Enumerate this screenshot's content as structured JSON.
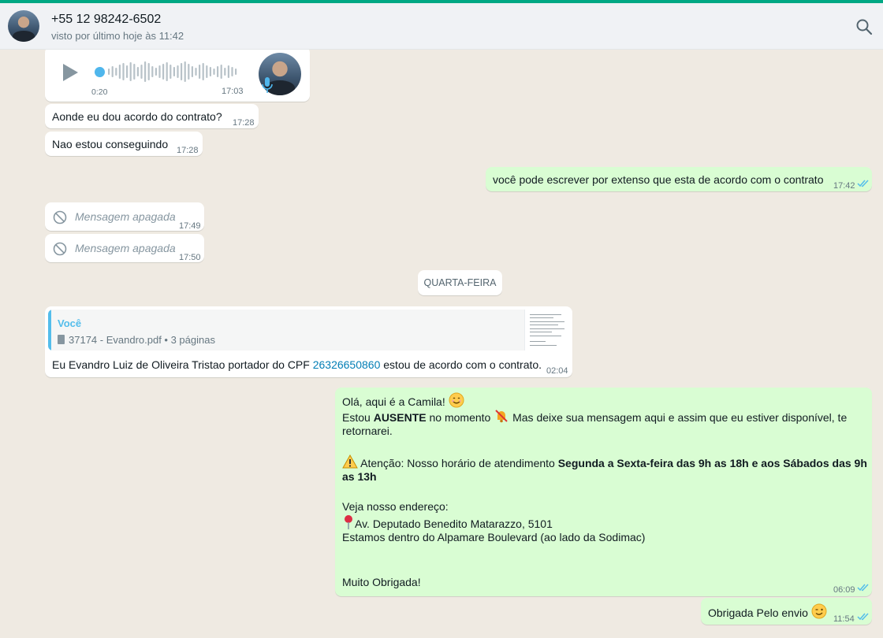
{
  "header": {
    "name": "+55 12 98242-6502",
    "status": "visto por último hoje às 11:42"
  },
  "audio": {
    "elapsed": "0:20",
    "time": "17:03"
  },
  "messages": [
    {
      "text": "Aonde eu dou acordo do contrato?",
      "time": "17:28"
    },
    {
      "text": "Nao estou conseguindo",
      "time": "17:28"
    },
    {
      "text": "você pode escrever por extenso que esta de acordo com o contrato",
      "time": "17:42"
    },
    {
      "text": "Mensagem apagada",
      "time": "17:49"
    },
    {
      "text": "Mensagem apagada",
      "time": "17:50"
    }
  ],
  "date_divider": "QUARTA-FEIRA",
  "reply": {
    "quoted_author": "Você",
    "quoted_doc": "37174 - Evandro.pdf • 3 páginas",
    "text_before": "Eu Evandro Luiz de Oliveira Tristao portador do CPF ",
    "cpf": "26326650860",
    "text_after": " estou de acordo com o contrato.",
    "time": "02:04"
  },
  "auto_reply": {
    "line1": "Olá, aqui é a Camila! ",
    "line2_a": "Estou ",
    "line2_b": "AUSENTE",
    "line2_c": " no momento ",
    "line2_d": " Mas deixe sua mensagem aqui e assim que eu estiver disponível, te",
    "line3": "retornarei.",
    "line4_a": " Atenção: Nosso horário de atendimento ",
    "line4_b": "Segunda a Sexta-feira das 9h as 18h e aos Sábados das 9h",
    "line5": "as 13h",
    "line6": "Veja nosso endereço:",
    "line7": "Av. Deputado Benedito Matarazzo, 5101",
    "line8": "Estamos dentro do Alpamare Boulevard (ao lado da Sodimac)",
    "line9": "Muito Obrigada!",
    "time": "06:09"
  },
  "last": {
    "text": "Obrigada Pelo envio ",
    "time": "11:54"
  },
  "colors": {
    "accent": "#00a884",
    "outgoing": "#d9fdd3",
    "tick_read": "#53bdeb",
    "link": "#027eb5"
  },
  "icons": [
    "search-icon",
    "play-icon",
    "mic-icon",
    "blocked-icon",
    "document-icon",
    "double-check-icon",
    "smile-emoji",
    "no-bell-emoji",
    "warning-emoji",
    "pin-emoji",
    "wink-emoji"
  ]
}
